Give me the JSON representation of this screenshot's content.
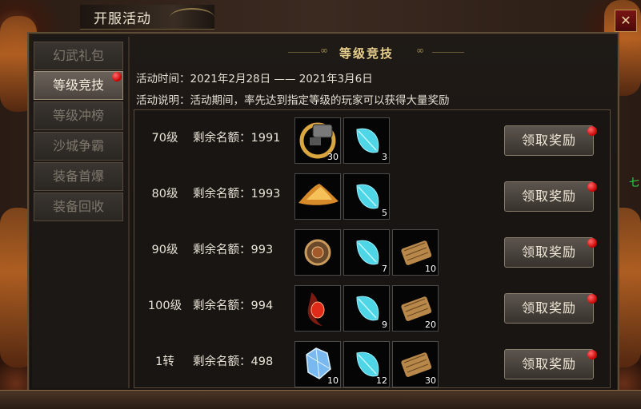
{
  "window": {
    "title": "开服活动",
    "close_label": "✕"
  },
  "nav": {
    "items": [
      {
        "label": "幻武礼包",
        "active": false,
        "dot": false
      },
      {
        "label": "等级竞技",
        "active": true,
        "dot": true
      },
      {
        "label": "等级冲榜",
        "active": false,
        "dot": false
      },
      {
        "label": "沙城争霸",
        "active": false,
        "dot": false
      },
      {
        "label": "装备首爆",
        "active": false,
        "dot": false
      },
      {
        "label": "装备回收",
        "active": false,
        "dot": false
      }
    ]
  },
  "section": {
    "title": "等级竞技",
    "time": "活动时间：2021年2月28日 —— 2021年3月6日",
    "desc": "活动说明：活动期间，率先达到指定等级的玩家可以获得大量奖励"
  },
  "rows": [
    {
      "level": "70级",
      "remaining": "剩余名额：1991",
      "items": [
        {
          "icon": "gear-ring-icon",
          "count": "30"
        },
        {
          "icon": "blue-leaf-icon",
          "count": "3"
        }
      ]
    },
    {
      "level": "80级",
      "remaining": "剩余名额：1993",
      "items": [
        {
          "icon": "gold-pile-icon",
          "count": ""
        },
        {
          "icon": "blue-leaf-icon",
          "count": "5"
        }
      ]
    },
    {
      "level": "90级",
      "remaining": "剩余名额：993",
      "items": [
        {
          "icon": "shield-orb-icon",
          "count": ""
        },
        {
          "icon": "blue-leaf-icon",
          "count": "7"
        },
        {
          "icon": "scroll-icon",
          "count": "10"
        }
      ]
    },
    {
      "level": "100级",
      "remaining": "剩余名额：994",
      "items": [
        {
          "icon": "red-gem-amulet-icon",
          "count": ""
        },
        {
          "icon": "blue-leaf-icon",
          "count": "9"
        },
        {
          "icon": "scroll-icon",
          "count": "20"
        }
      ]
    },
    {
      "level": "1转",
      "remaining": "剩余名额：498",
      "items": [
        {
          "icon": "crystal-icon",
          "count": "10"
        },
        {
          "icon": "blue-leaf-icon",
          "count": "12"
        },
        {
          "icon": "scroll-icon",
          "count": "30"
        }
      ]
    }
  ],
  "claim_label": "领取奖励",
  "side_tag": "七",
  "colors": {
    "accent_gold": "#e7cf8c",
    "notify_red": "#d40000",
    "text_light": "#e9e3d6"
  }
}
